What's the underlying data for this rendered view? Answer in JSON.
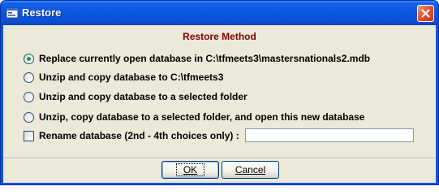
{
  "window": {
    "title": "Restore",
    "icon": "form-icon",
    "close_icon": "close-icon",
    "colors": {
      "titlebar": "#0b55e0",
      "client": "#ece9d8",
      "heading": "#800000",
      "close": "#e2542e"
    }
  },
  "heading": "Restore Method",
  "options": [
    {
      "label": "Replace currently open database in C:\\tfmeets3\\mastersnationals2.mdb",
      "checked": true
    },
    {
      "label": "Unzip and copy database to C:\\tfmeets3",
      "checked": false
    },
    {
      "label": "Unzip and copy database to a selected folder",
      "checked": false
    },
    {
      "label": "Unzip, copy database to a selected folder, and open this new database",
      "checked": false
    }
  ],
  "rename": {
    "label": "Rename database (2nd - 4th choices only) :",
    "checked": false,
    "value": ""
  },
  "buttons": {
    "ok": "OK",
    "cancel": "Cancel"
  }
}
